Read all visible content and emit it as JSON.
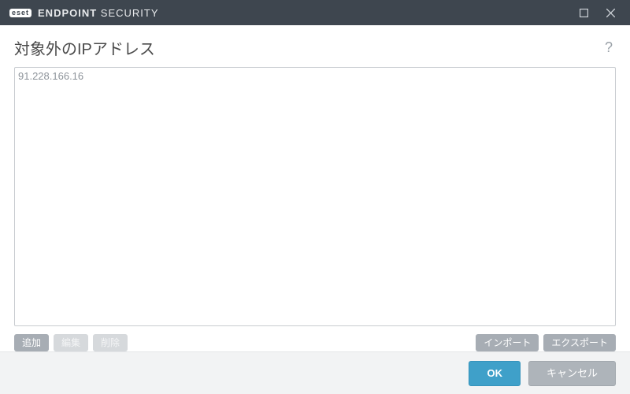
{
  "titlebar": {
    "logo_text": "eset",
    "product_bold": "ENDPOINT",
    "product_rest": " SECURITY"
  },
  "heading": "対象外のIPアドレス",
  "help_symbol": "?",
  "ip_list": {
    "items": [
      "91.228.166.16"
    ]
  },
  "list_actions": {
    "add": "追加",
    "edit": "編集",
    "delete": "削除",
    "import": "インポート",
    "export": "エクスポート"
  },
  "footer": {
    "ok": "OK",
    "cancel": "キャンセル"
  }
}
